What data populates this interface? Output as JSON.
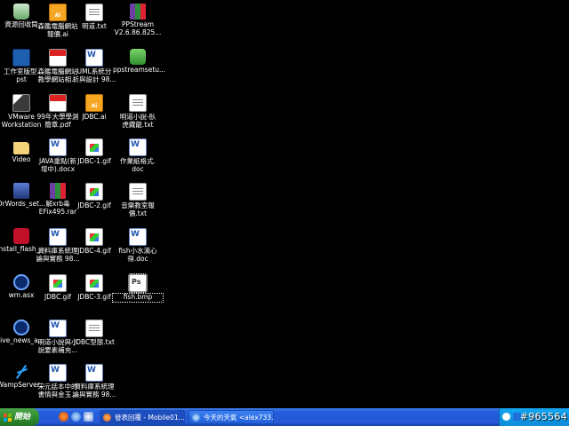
{
  "desktop_icons": [
    {
      "name": "recycle-bin-icon",
      "label": "資源回收筒",
      "type": "recycle"
    },
    {
      "name": "file-icon",
      "label": "森鑑電腦網站\n報價.ai",
      "type": "ai"
    },
    {
      "name": "file-icon",
      "label": "明道.txt",
      "type": "txt"
    },
    {
      "name": "file-icon",
      "label": "PPStream\nV2.6.86.825...",
      "type": "rar"
    },
    {
      "name": "file-icon",
      "label": "工作室版型.\npst",
      "type": "ppt"
    },
    {
      "name": "file-icon",
      "label": "森鑑電腦網站\n教學網站相...",
      "type": "pdf"
    },
    {
      "name": "file-icon",
      "label": "UML系統分\n析與設計 98...",
      "type": "doc"
    },
    {
      "name": "file-icon",
      "label": "ppstreamsetu...",
      "type": "exe"
    },
    {
      "name": "vmware-icon",
      "label": "VMware\nWorkstation",
      "type": "vm"
    },
    {
      "name": "file-icon",
      "label": "99年大學學測\n簡章.pdf",
      "type": "pdf"
    },
    {
      "name": "file-icon",
      "label": "JDBC.ai",
      "type": "ai"
    },
    {
      "name": "file-icon",
      "label": "明道小說-臥\n虎藏龍.txt",
      "type": "txt"
    },
    {
      "name": "folder-icon",
      "label": "Video",
      "type": "folder"
    },
    {
      "name": "file-icon",
      "label": "JAVA重點(新\n增中).docx",
      "type": "doc"
    },
    {
      "name": "file-icon",
      "label": "JDBC-1.gif",
      "type": "gif"
    },
    {
      "name": "file-icon",
      "label": "作業紙格式.\ndoc",
      "type": "doc"
    },
    {
      "name": "app-icon",
      "label": "DrWords_set...",
      "type": "drw"
    },
    {
      "name": "file-icon",
      "label": "解xrb毒\nEFix495.rar",
      "type": "rar"
    },
    {
      "name": "file-icon",
      "label": "JDBC-2.gif",
      "type": "gif"
    },
    {
      "name": "file-icon",
      "label": "音樂教室報\n價.txt",
      "type": "txt"
    },
    {
      "name": "flash-icon",
      "label": "install_flash_...",
      "type": "flash"
    },
    {
      "name": "file-icon",
      "label": "資料庫系統理\n論與實務 98...",
      "type": "doc"
    },
    {
      "name": "file-icon",
      "label": "JDBC-4.gif",
      "type": "gif"
    },
    {
      "name": "file-icon",
      "label": "fish小水滴心\n得.doc",
      "type": "doc"
    },
    {
      "name": "media-icon",
      "label": "wm.asx",
      "type": "wm"
    },
    {
      "name": "file-icon",
      "label": "JDBC.gif",
      "type": "gif"
    },
    {
      "name": "file-icon",
      "label": "JDBC-3.gif",
      "type": "gif"
    },
    {
      "name": "file-icon",
      "label": "fish.bmp",
      "type": "ps",
      "selected": true
    },
    {
      "name": "media-icon",
      "label": "live_news_a...",
      "type": "wm"
    },
    {
      "name": "file-icon",
      "label": "明道小說與小\n說要素補充...",
      "type": "doc"
    },
    {
      "name": "file-icon",
      "label": "JDBC型態.txt",
      "type": "txt"
    },
    {
      "name": "wamp-icon",
      "label": "WampServer...",
      "type": "wamp"
    },
    {
      "name": "file-icon",
      "label": "宋元話本中的\n書情與金玉...",
      "type": "doc"
    },
    {
      "name": "file-icon",
      "label": "資料庫系統理\n論與實務 98...",
      "type": "doc"
    }
  ],
  "taskbar": {
    "start_label": "開始",
    "windows": [
      {
        "label": "發表回覆 - Mobile01..."
      },
      {
        "label": "今天的天氣 <alex733..."
      }
    ]
  },
  "watermark": "#965564"
}
